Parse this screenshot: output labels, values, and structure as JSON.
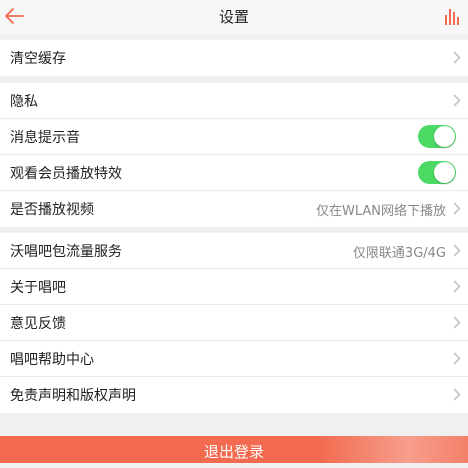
{
  "header": {
    "title": "设置",
    "back_icon": "back-arrow-icon",
    "right_icon": "bar-chart-icon",
    "accent_color": "#f26a4f"
  },
  "groups": [
    {
      "items": [
        {
          "label": "清空缓存",
          "control": "chevron"
        }
      ]
    },
    {
      "items": [
        {
          "label": "隐私",
          "control": "chevron"
        },
        {
          "label": "消息提示音",
          "control": "toggle",
          "on": true
        },
        {
          "label": "观看会员播放特效",
          "control": "toggle",
          "on": true
        },
        {
          "label": "是否播放视频",
          "value": "仅在WLAN网络下播放",
          "control": "chevron"
        }
      ]
    },
    {
      "items": [
        {
          "label": "沃唱吧包流量服务",
          "value": "仅限联通3G/4G",
          "control": "chevron"
        },
        {
          "label": "关于唱吧",
          "control": "chevron"
        },
        {
          "label": "意见反馈",
          "control": "chevron"
        },
        {
          "label": "唱吧帮助中心",
          "control": "chevron"
        },
        {
          "label": "免责声明和版权声明",
          "control": "chevron"
        }
      ]
    }
  ],
  "logout": {
    "label": "退出登录"
  },
  "colors": {
    "toggle_on": "#4cd964",
    "logout_bg": "#f26a4f",
    "page_bg": "#f0f0f0"
  }
}
